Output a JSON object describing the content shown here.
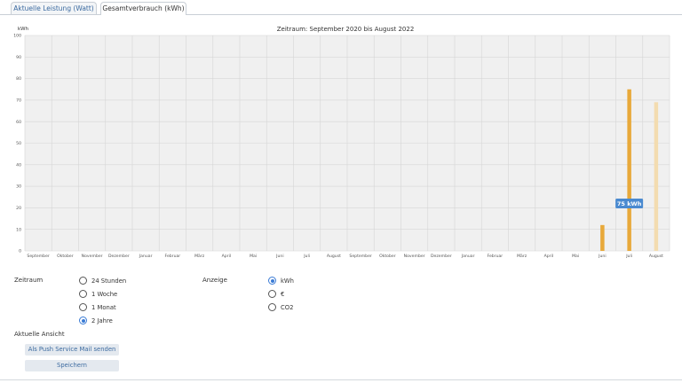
{
  "tabs": [
    {
      "label": "Aktuelle Leistung (Watt)",
      "active": false
    },
    {
      "label": "Gesamtverbrauch (kWh)",
      "active": true
    }
  ],
  "chart_data": {
    "type": "bar",
    "title": "Zeitraum: September 2020 bis August 2022",
    "ylabel": "kWh",
    "xlabel": "",
    "ylim": [
      0,
      100
    ],
    "yticks": [
      0,
      10,
      20,
      30,
      40,
      50,
      60,
      70,
      80,
      90,
      100
    ],
    "grid": true,
    "categories": [
      "September",
      "Oktober",
      "November",
      "Dezember",
      "Januar",
      "Februar",
      "März",
      "April",
      "Mai",
      "Juni",
      "Juli",
      "August",
      "September",
      "Oktober",
      "November",
      "Dezember",
      "Januar",
      "Februar",
      "März",
      "April",
      "Mai",
      "Juni",
      "Juli",
      "August"
    ],
    "values": [
      0,
      0,
      0,
      0,
      0,
      0,
      0,
      0,
      0,
      0,
      0,
      0,
      0,
      0,
      0,
      0,
      0,
      0,
      0,
      0,
      0,
      12,
      75,
      69
    ],
    "colors": {
      "bar": "#e8a93a",
      "bar_current": "#f3dcb0",
      "tooltip": "#4a8ad0",
      "plot_bg": "#f0f0f0",
      "grid": "#d6d6d6"
    },
    "tooltip": {
      "index": 22,
      "text": "75 kWh"
    }
  },
  "controls": {
    "zeitraum_label": "Zeitraum",
    "zeitraum_options": [
      {
        "label": "24 Stunden",
        "checked": false
      },
      {
        "label": "1 Woche",
        "checked": false
      },
      {
        "label": "1 Monat",
        "checked": false
      },
      {
        "label": "2 Jahre",
        "checked": true
      }
    ],
    "anzeige_label": "Anzeige",
    "anzeige_options": [
      {
        "label": "kWh",
        "checked": true
      },
      {
        "label": "€",
        "checked": false
      },
      {
        "label": "CO2",
        "checked": false
      }
    ],
    "aktuelle_ansicht_label": "Aktuelle Ansicht",
    "push_button": "Als Push Service Mail senden",
    "save_button": "Speichern"
  }
}
